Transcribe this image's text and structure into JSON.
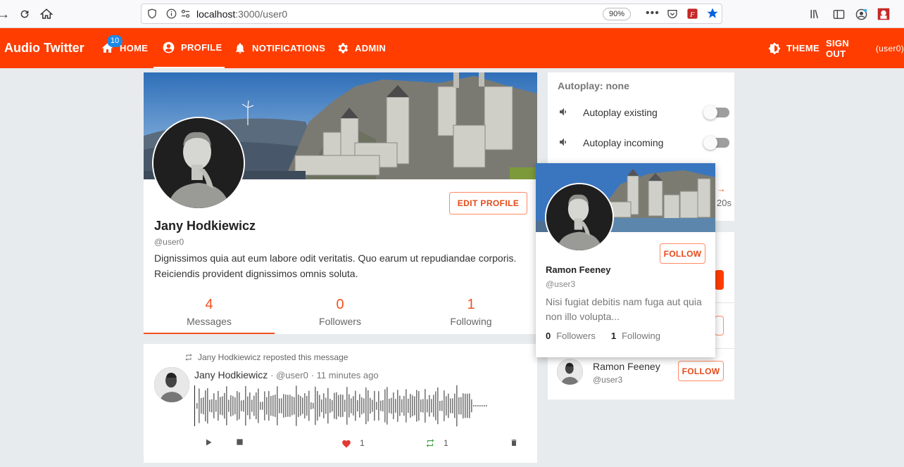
{
  "browser": {
    "url_host": "localhost",
    "url_rest": ":3000/user0",
    "zoom": "90%"
  },
  "appbar": {
    "title": "Audio Twitter",
    "nav": {
      "home": "HOME",
      "profile": "PROFILE",
      "notifications": "NOTIFICATIONS",
      "admin": "ADMIN",
      "theme": "THEME",
      "sign_out": "SIGN OUT",
      "user": "(user0)"
    },
    "home_badge": "10"
  },
  "profile": {
    "name": "Jany Hodkiewicz",
    "handle": "@user0",
    "bio": "Dignissimos quia aut eum labore odit veritatis. Quo earum ut repudiandae corporis. Reiciendis provident dignissimos omnis soluta.",
    "edit_label": "EDIT PROFILE",
    "stats": [
      {
        "value": "4",
        "label": "Messages"
      },
      {
        "value": "0",
        "label": "Followers"
      },
      {
        "value": "1",
        "label": "Following"
      }
    ]
  },
  "message": {
    "repost_text": "Jany Hodkiewicz reposted this message",
    "author": "Jany Hodkiewicz",
    "handle": "@user0",
    "time": "11 minutes ago",
    "likes": "1",
    "reposts": "1"
  },
  "autoplay": {
    "title": "Autoplay: none",
    "existing_label": "Autoplay existing",
    "incoming_label": "Autoplay incoming",
    "partial_text": "20s"
  },
  "who_to_follow": {
    "user": {
      "name": "Ramon Feeney",
      "handle": "@user3",
      "follow_label": "FOLLOW"
    }
  },
  "hover_card": {
    "name": "Ramon Feeney",
    "handle": "@user3",
    "bio": "Nisi fugiat debitis nam fuga aut quia non illo volupta...",
    "followers_count": "0",
    "followers_label": "Followers",
    "following_count": "1",
    "following_label": "Following",
    "follow_label": "FOLLOW"
  },
  "colors": {
    "primary": "#ff3d00",
    "accent_text": "#e64a19",
    "badge": "#1e88e5",
    "like": "#e53935",
    "repost": "#43a047"
  }
}
